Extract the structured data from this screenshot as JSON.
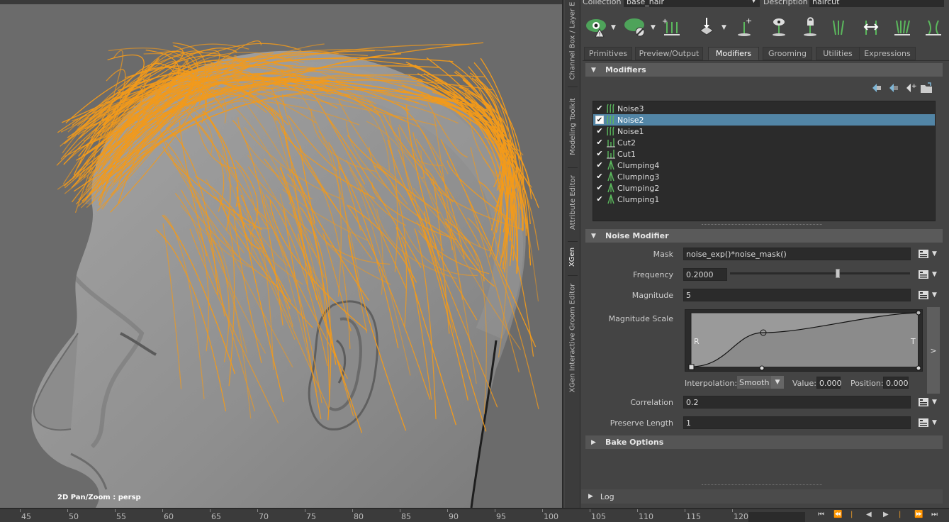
{
  "collection_row": {
    "collection_label": "Collection",
    "collection_value": "base_hair",
    "description_label": "Description",
    "description_value": "haircut"
  },
  "side_tabs": [
    {
      "label": "Channel Box / Layer E",
      "active": false
    },
    {
      "label": "Modeling Toolkit",
      "active": false
    },
    {
      "label": "Attribute Editor",
      "active": false
    },
    {
      "label": "XGen",
      "active": true
    },
    {
      "label": "XGen Interactive Groom Editor",
      "active": false
    }
  ],
  "tabs": [
    {
      "label": "Primitives"
    },
    {
      "label": "Preview/Output"
    },
    {
      "label": "Modifiers"
    },
    {
      "label": "Grooming"
    },
    {
      "label": "Utilities"
    },
    {
      "label": "Expressions"
    }
  ],
  "active_tab": "Modifiers",
  "modifiers_section": {
    "title": "Modifiers",
    "items": [
      {
        "label": "Noise3",
        "checked": true,
        "icon": "noise-icon",
        "selected": false
      },
      {
        "label": "Noise2",
        "checked": true,
        "icon": "noise-icon",
        "selected": true
      },
      {
        "label": "Noise1",
        "checked": true,
        "icon": "noise-icon",
        "selected": false
      },
      {
        "label": "Cut2",
        "checked": true,
        "icon": "cut-icon",
        "selected": false
      },
      {
        "label": "Cut1",
        "checked": true,
        "icon": "cut-icon",
        "selected": false
      },
      {
        "label": "Clumping4",
        "checked": true,
        "icon": "clump-icon",
        "selected": false
      },
      {
        "label": "Clumping3",
        "checked": true,
        "icon": "clump-icon",
        "selected": false
      },
      {
        "label": "Clumping2",
        "checked": true,
        "icon": "clump-icon",
        "selected": false
      },
      {
        "label": "Clumping1",
        "checked": true,
        "icon": "clump-icon",
        "selected": false
      }
    ]
  },
  "noise_section": {
    "title": "Noise Modifier",
    "mask_label": "Mask",
    "mask_value": "noise_exp()*noise_mask()",
    "frequency_label": "Frequency",
    "frequency_value": "0.2000",
    "frequency_slider_fraction": 0.6,
    "magnitude_label": "Magnitude",
    "magnitude_value": "5",
    "magnitude_scale_label": "Magnitude Scale",
    "ramp_left_label": "R",
    "ramp_right_label": "T",
    "ramp_expand_label": ">",
    "interpolation_label": "Interpolation:",
    "interpolation_value": "Smooth",
    "value_label": "Value:",
    "value_value": "0.000",
    "position_label": "Position:",
    "position_value": "0.000",
    "correlation_label": "Correlation",
    "correlation_value": "0.2",
    "preserve_length_label": "Preserve Length",
    "preserve_length_value": "1"
  },
  "bake_options_label": "Bake Options",
  "log_label": "Log",
  "viewport": {
    "camera_label": "2D Pan/Zoom : persp",
    "hair_color": "#f29a1b"
  },
  "timeline": {
    "ticks": [
      "45",
      "50",
      "55",
      "60",
      "65",
      "70",
      "75",
      "80",
      "85",
      "90",
      "95",
      "100",
      "105",
      "110",
      "115",
      "120"
    ]
  },
  "colors": {
    "accent_selection": "#5285a6",
    "icon_green": "#5bb85d"
  }
}
